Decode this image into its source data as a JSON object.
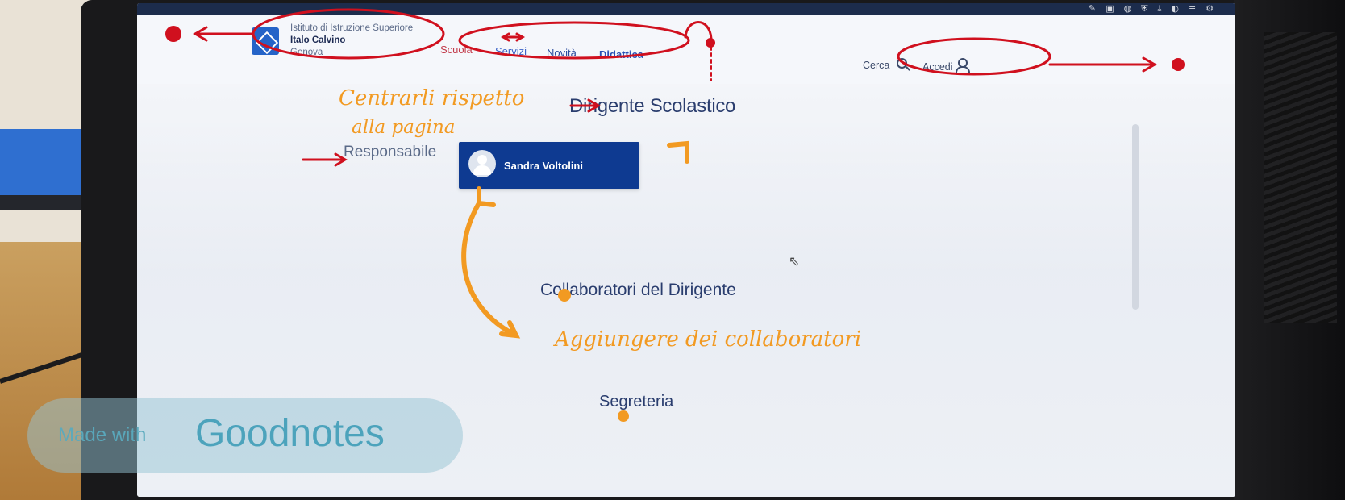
{
  "header": {
    "school_line1": "Istituto di Istruzione Superiore",
    "school_name": "Italo Calvino",
    "school_city": "Genova",
    "nav": [
      "Scuola",
      "Servizi",
      "Novità",
      "Didattica"
    ],
    "search_label": "Cerca",
    "login_label": "Accedi"
  },
  "main": {
    "section_title": "Dirigente Scolastico",
    "role_label": "Responsabile",
    "person_name": "Sandra Voltolini",
    "collaborators_title": "Collaboratori del Dirigente",
    "secretariat_title": "Segreteria"
  },
  "annotations": {
    "center_note_line1": "Centrarli rispetto",
    "center_note_line2": "alla pagina",
    "collab_note": "Aggiungere dei collaboratori",
    "pen_red": "#d0101e",
    "pen_orange": "#f29a22"
  },
  "watermark": {
    "made_with": "Made with",
    "brand": "Goodnotes"
  }
}
